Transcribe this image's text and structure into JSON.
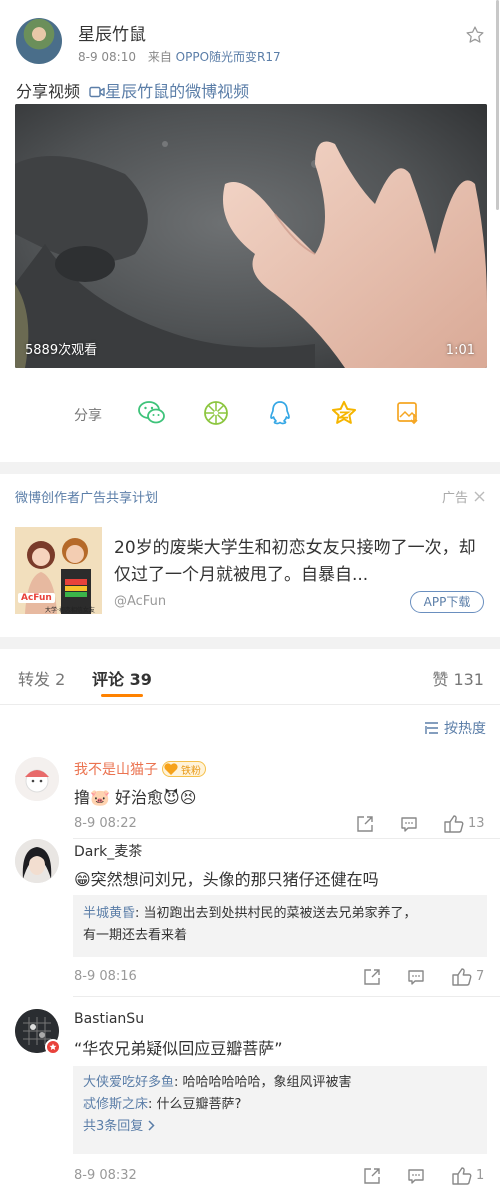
{
  "post": {
    "author": "星辰竹鼠",
    "time": "8-9 08:10",
    "source_prefix": "来自",
    "source": "OPPO随光而变R17",
    "share_text": "分享视频",
    "video_link": "星辰竹鼠的微博视频",
    "views": "5889次观看",
    "duration": "1:01"
  },
  "share_bar": {
    "label": "分享",
    "icons": [
      "wechat-icon",
      "moments-icon",
      "qq-icon",
      "qzone-icon",
      "save-image-icon"
    ],
    "accent": "#3ec37a"
  },
  "ad": {
    "program": "微博创作者广告共享计划",
    "tag": "广告",
    "title": "20岁的废柴大学生和初恋女友只接吻了一次，却仅过了一个月就被甩了。自暴自...",
    "account": "@AcFun",
    "button": "APP下载",
    "thumb_logo": "AcFun",
    "thumb_caption": "大学·初恋相信女友"
  },
  "tabs": {
    "repost": "转发 2",
    "comment": "评论 39",
    "like": "赞 131"
  },
  "sort": {
    "label": "按热度"
  },
  "comments": [
    {
      "user": "我不是山猫子",
      "badge": "铁粉",
      "text": "撸🐷 好治愈😈😣",
      "time": "8-9 08:22",
      "likes": "13"
    },
    {
      "user": "Dark_麦茶",
      "text": "😁突然想问刘兄，头像的那只猪仔还健在吗",
      "reply_user": "半城黄昏",
      "reply_text": ": 当初跑出去到处拱村民的菜被送去兄弟家养了，",
      "reply_text2": "有一期还去看来着",
      "time": "8-9 08:16",
      "likes": "7"
    },
    {
      "user": "BastianSu",
      "text": "“华农兄弟疑似回应豆瓣菩萨”",
      "reply1_user": "大侠爱吃好多鱼",
      "reply1_text": ": 哈哈哈哈哈哈，象组风评被害",
      "reply2_user": "忒修斯之床",
      "reply2_text": ": 什么豆瓣菩萨?",
      "more": "共3条回复 ",
      "time": "8-9 08:32",
      "likes": "1"
    }
  ]
}
